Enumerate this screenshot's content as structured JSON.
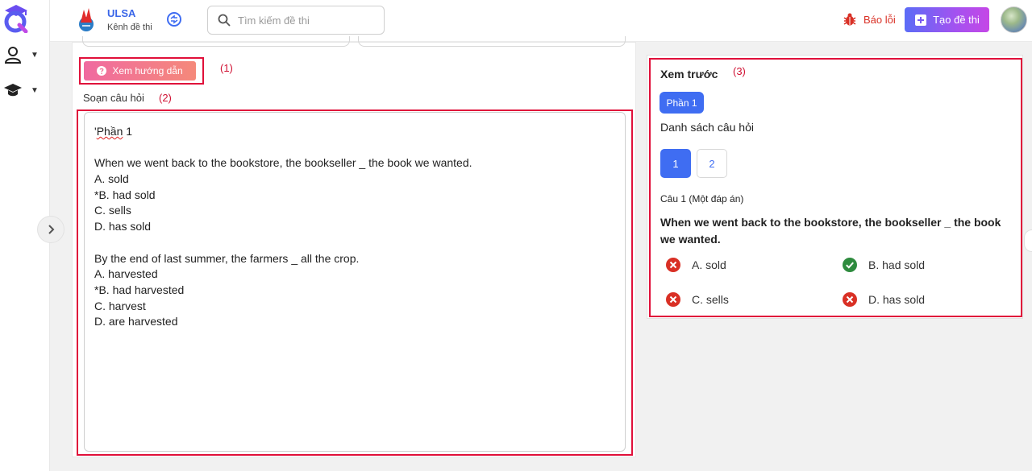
{
  "header": {
    "brand_name": "ULSA",
    "brand_sub": "Kênh đề thi",
    "search_placeholder": "Tìm kiếm đề thi",
    "report_label": "Báo lỗi",
    "create_label": "Tạo đề thi"
  },
  "left": {
    "guide_label": "Xem hướng dẫn",
    "annot_1": "(1)",
    "compose_label": "Soạn câu hỏi",
    "annot_2": "(2)",
    "editor_lines": [
      "'Phần 1",
      "",
      "When we went back to the bookstore, the bookseller _ the book we wanted.",
      "A. sold",
      "*B. had sold",
      "C. sells",
      "D. has sold",
      "",
      "By the end of last summer, the farmers _ all the crop.",
      "A. harvested",
      "*B. had harvested",
      "C. harvest",
      "D. are harvested"
    ]
  },
  "preview": {
    "title": "Xem trước",
    "annot_3": "(3)",
    "part_label": "Phần 1",
    "list_title": "Danh sách câu hỏi",
    "question_numbers": [
      "1",
      "2"
    ],
    "question_type": "Câu 1 (Một đáp án)",
    "question_text": "When we went back to the bookstore, the bookseller _ the book we wanted.",
    "options": [
      {
        "label": "A. sold",
        "correct": false
      },
      {
        "label": "B. had sold",
        "correct": true
      },
      {
        "label": "C. sells",
        "correct": false
      },
      {
        "label": "D. has sold",
        "correct": false
      }
    ]
  },
  "colors": {
    "accent_blue": "#3f6df2",
    "annotation_red": "#e0103a",
    "correct_green": "#2e8b3e",
    "wrong_red": "#d93025"
  }
}
